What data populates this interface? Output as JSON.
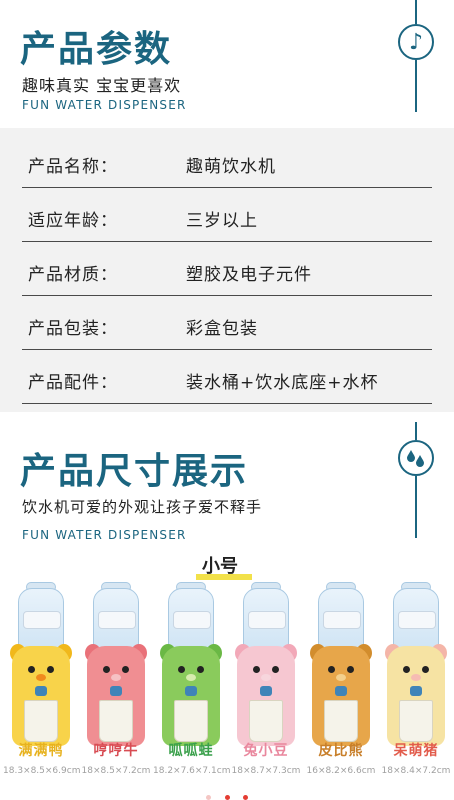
{
  "header": {
    "title": "产品参数",
    "subtitle": "趣味真实  宝宝更喜欢",
    "english": "FUN WATER DISPENSER",
    "badge_icon": "music-note-icon",
    "badge_glyph": "♪"
  },
  "specs": [
    {
      "key": "产品名称：",
      "value": "趣萌饮水机"
    },
    {
      "key": "适应年龄：",
      "value": "三岁以上"
    },
    {
      "key": "产品材质：",
      "value": "塑胶及电子元件"
    },
    {
      "key": "产品包装：",
      "value": "彩盒包装"
    },
    {
      "key": "产品配件：",
      "value": "装水桶+饮水底座+水杯"
    }
  ],
  "size_section": {
    "title": "产品尺寸展示",
    "subtitle": "饮水机可爱的外观让孩子爱不释手",
    "english": "FUN WATER DISPENSER",
    "badge_icon": "water-drops-icon",
    "badge_glyph": "💧",
    "size_label": "小号"
  },
  "products": [
    {
      "name": "满满鸭",
      "dims": "18.3×8.5×6.9cm",
      "name_color": "#e7b21f",
      "body_color": "#f8d34a",
      "ear_color": "#f1b81b",
      "nose_color": "#f08a1d"
    },
    {
      "name": "哼哼牛",
      "dims": "18×8.5×7.2cm",
      "name_color": "#d84c53",
      "body_color": "#f08e92",
      "ear_color": "#e97179",
      "nose_color": "#f6c1c4"
    },
    {
      "name": "呱呱蛙",
      "dims": "18.2×7.6×7.1cm",
      "name_color": "#3aa04b",
      "body_color": "#8acb5c",
      "ear_color": "#6ab845",
      "nose_color": "#d8ecb0"
    },
    {
      "name": "兔小豆",
      "dims": "18×8.7×7.3cm",
      "name_color": "#e9879d",
      "body_color": "#f6c7d1",
      "ear_color": "#f2a8b8",
      "nose_color": "#f7d6dd"
    },
    {
      "name": "皮比熊",
      "dims": "16×8.2×6.6cm",
      "name_color": "#c87f2a",
      "body_color": "#e7a64a",
      "ear_color": "#d28d2d",
      "nose_color": "#f3d08d"
    },
    {
      "name": "呆萌猪",
      "dims": "18×8.4×7.2cm",
      "name_color": "#e25c4c",
      "body_color": "#f6e3a3",
      "ear_color": "#f4b5a8",
      "nose_color": "#f6bcb3"
    }
  ],
  "pager": {
    "dot_colors": [
      "#f4c6c4",
      "#e43d33",
      "#e43d33"
    ]
  }
}
